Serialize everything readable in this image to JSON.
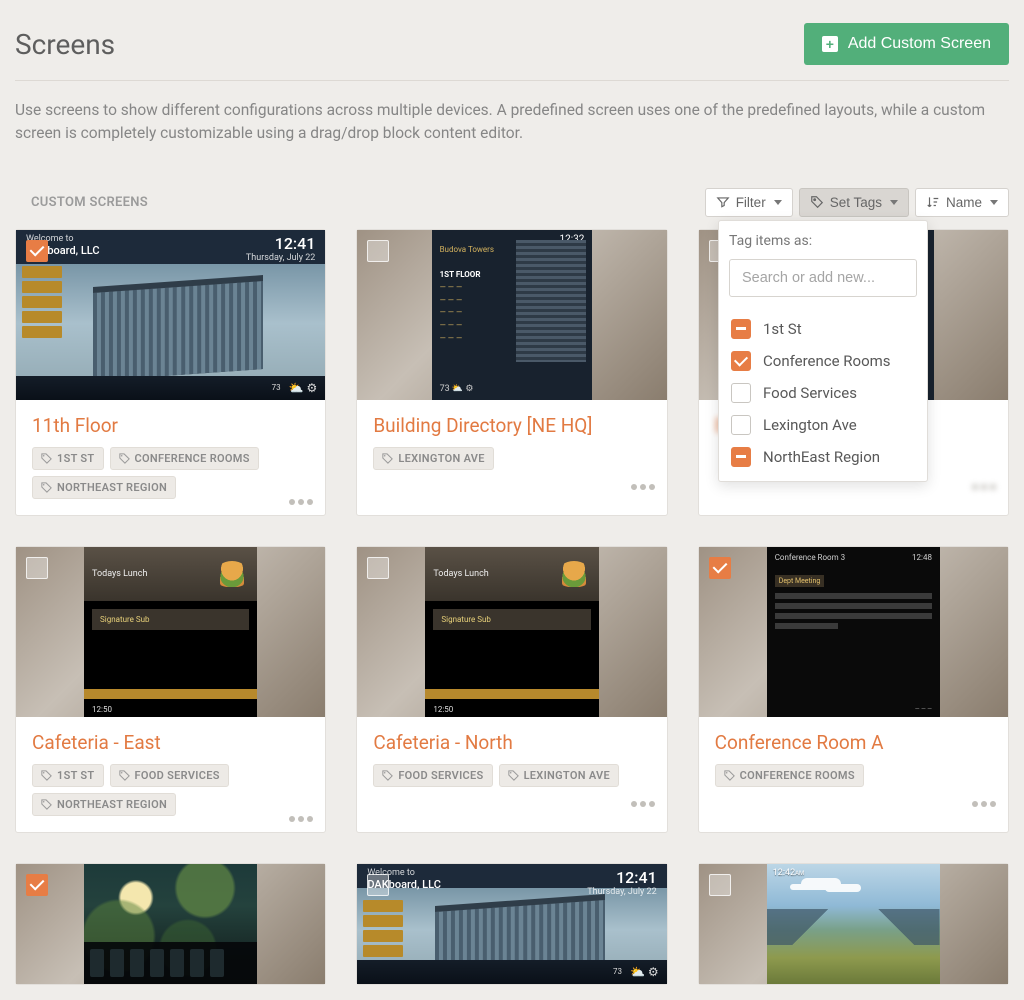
{
  "header": {
    "title": "Screens",
    "add_button": "Add Custom Screen"
  },
  "description": "Use screens to show different configurations across multiple devices. A predefined screen uses one of the predefined layouts, while a custom screen is completely customizable using a drag/drop block content editor.",
  "section_label": "CUSTOM SCREENS",
  "toolbar": {
    "filter": "Filter",
    "set_tags": "Set Tags",
    "sort": "Name"
  },
  "tag_popup": {
    "label": "Tag items as:",
    "search_placeholder": "Search or add new...",
    "options": [
      {
        "label": "1st St",
        "state": "partial"
      },
      {
        "label": "Conference Rooms",
        "state": "checked"
      },
      {
        "label": "Food Services",
        "state": "empty"
      },
      {
        "label": "Lexington Ave",
        "state": "empty"
      },
      {
        "label": "NorthEast Region",
        "state": "partial"
      }
    ]
  },
  "thumbs": {
    "office": {
      "welcome": "Welcome to",
      "org": "DAKboard, LLC",
      "clock": "12:41",
      "date": "Thursday, July 22",
      "temp": "73"
    },
    "directory": {
      "title": "Budova Towers",
      "floor": "1ST FLOOR",
      "clock": "12:32"
    },
    "lunch": {
      "heading": "Todays Lunch",
      "item": "Signature Sub",
      "clock": "12:50"
    },
    "conf": {
      "room": "Conference Room 3",
      "clock": "12:48",
      "meeting": "Dept Meeting"
    },
    "land": {
      "clock": "12:42"
    }
  },
  "cards": [
    {
      "title": "11th Floor",
      "selected": true,
      "scene": "office",
      "tags": [
        "1ST ST",
        "CONFERENCE ROOMS",
        "NORTHEAST REGION"
      ]
    },
    {
      "title": "Building Directory [NE HQ]",
      "selected": false,
      "scene": "directory",
      "tags": [
        "LEXINGTON AVE"
      ]
    },
    {
      "title": "B",
      "selected": false,
      "scene": "directory",
      "tags": [],
      "obscured": true
    },
    {
      "title": "Cafeteria - East",
      "selected": false,
      "scene": "lunch",
      "tags": [
        "1ST ST",
        "FOOD SERVICES",
        "NORTHEAST REGION"
      ]
    },
    {
      "title": "Cafeteria - North",
      "selected": false,
      "scene": "lunch",
      "tags": [
        "FOOD SERVICES",
        "LEXINGTON AVE"
      ]
    },
    {
      "title": "Conference Room A",
      "selected": true,
      "scene": "conf",
      "tags": [
        "CONFERENCE ROOMS"
      ]
    },
    {
      "title": "",
      "selected": true,
      "scene": "weather",
      "tags": [],
      "partial": true
    },
    {
      "title": "",
      "selected": false,
      "scene": "office",
      "tags": [],
      "partial": true
    },
    {
      "title": "",
      "selected": false,
      "scene": "land",
      "tags": [],
      "partial": true
    }
  ]
}
